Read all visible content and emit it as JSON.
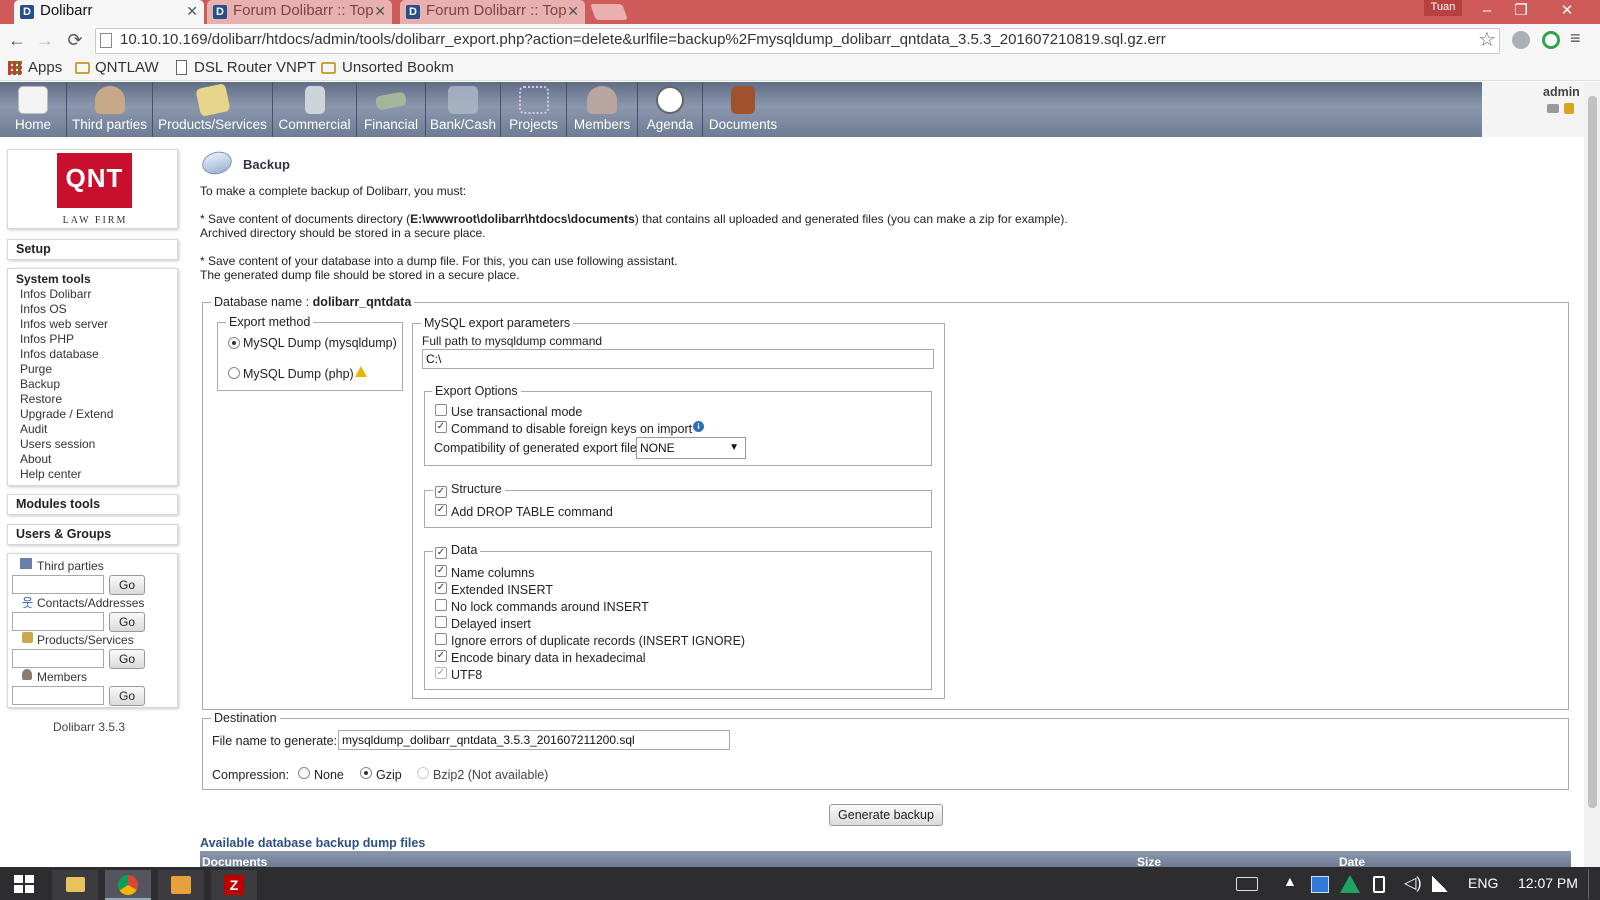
{
  "browser": {
    "tabs": [
      {
        "title": "Dolibarr",
        "favicon": "D",
        "active": true
      },
      {
        "title": "Forum Dolibarr :: Top",
        "favicon": "D",
        "active": false
      },
      {
        "title": "Forum Dolibarr :: Top",
        "favicon": "D",
        "active": false
      }
    ],
    "user_chip": "Tuan",
    "url": "10.10.10.169/dolibarr/htdocs/admin/tools/dolibarr_export.php?action=delete&urlfile=backup%2Fmysqldump_dolibarr_qntdata_3.5.3_201607210819.sql.gz.err",
    "bookmarks": [
      {
        "label": "Apps",
        "icon": "apps-grid-icon"
      },
      {
        "label": "QNTLAW",
        "icon": "folder-icon"
      },
      {
        "label": "DSL Router VNPT",
        "icon": "page-icon"
      },
      {
        "label": "Unsorted Bookm",
        "icon": "folder-icon"
      }
    ],
    "colors": {
      "tabbar": "#cf5a5a",
      "active_tab": "#f6f6f6"
    }
  },
  "app": {
    "menu": [
      {
        "label": "Home",
        "icon": "home-icon",
        "color": "#f3f3f3"
      },
      {
        "label": "Third parties",
        "icon": "third-parties-icon",
        "color": "#c7a98a"
      },
      {
        "label": "Products/Services",
        "icon": "products-icon",
        "color": "#e6d68a"
      },
      {
        "label": "Commercial",
        "icon": "commercial-icon",
        "color": "#cfd3da"
      },
      {
        "label": "Financial",
        "icon": "financial-icon",
        "color": "#a3b59a"
      },
      {
        "label": "Bank/Cash",
        "icon": "bank-icon",
        "color": "#aeb8c8"
      },
      {
        "label": "Projects",
        "icon": "projects-icon",
        "color": "#b7a6d0"
      },
      {
        "label": "Members",
        "icon": "members-icon",
        "color": "#b8a5a0"
      },
      {
        "label": "Agenda",
        "icon": "clock-icon",
        "color": "#ffffff"
      },
      {
        "label": "Documents",
        "icon": "documents-icon",
        "color": "#a0522d"
      }
    ],
    "user": "admin",
    "logo": {
      "letters": "QNT",
      "tagline": "LAW FIRM"
    },
    "sidebar": {
      "setup": "Setup",
      "system_tools": {
        "title": "System tools",
        "items": [
          "Infos Dolibarr",
          "Infos OS",
          "Infos web server",
          "Infos PHP",
          "Infos database",
          "Purge",
          "Backup",
          "Restore",
          "Upgrade / Extend",
          "Audit",
          "Users session",
          "About",
          "Help center"
        ]
      },
      "modules_tools": "Modules tools",
      "users_groups": "Users & Groups",
      "search": [
        {
          "label": "Third parties",
          "icon": "third-parties-small-icon",
          "button": "Go"
        },
        {
          "label": "Contacts/Addresses",
          "icon": "contact-small-icon",
          "button": "Go"
        },
        {
          "label": "Products/Services",
          "icon": "product-small-icon",
          "button": "Go"
        },
        {
          "label": "Members",
          "icon": "member-small-icon",
          "button": "Go"
        }
      ],
      "version": "Dolibarr 3.5.3"
    },
    "page": {
      "title": "Backup",
      "intro": "To make a complete backup of Dolibarr, you must:",
      "docs_pre": "* Save content of documents directory (",
      "docs_path": "E:\\wwwroot\\dolibarr\\htdocs\\documents",
      "docs_post": ") that contains all uploaded and generated files (you can make a zip for example).",
      "docs_line2": "Archived directory should be stored in a secure place.",
      "db_line1": "* Save content of your database into a dump file. For this, you can use following assistant.",
      "db_line2": "The generated dump file should be stored in a secure place.",
      "dbname_label": "Database name : ",
      "dbname": "dolibarr_qntdata",
      "export_method": {
        "legend": "Export method",
        "options": [
          {
            "label": "MySQL Dump (mysqldump)",
            "selected": true
          },
          {
            "label": "MySQL Dump (php)",
            "selected": false,
            "warning": true
          }
        ]
      },
      "params": {
        "legend": "MySQL export parameters",
        "path_label": "Full path to mysqldump command",
        "path_value": "C:\\",
        "export_options": {
          "legend": "Export Options",
          "checks": [
            {
              "label": "Use transactional mode",
              "checked": false
            },
            {
              "label": "Command to disable foreign keys on import",
              "checked": true,
              "info": true
            }
          ],
          "compat_label": "Compatibility of generated export file",
          "compat_value": "NONE"
        },
        "structure": {
          "legend": "Structure",
          "checked": true,
          "checks": [
            {
              "label": "Add DROP TABLE command",
              "checked": true
            }
          ]
        },
        "data": {
          "legend": "Data",
          "checked": true,
          "checks": [
            {
              "label": "Name columns",
              "checked": true
            },
            {
              "label": "Extended INSERT",
              "checked": true
            },
            {
              "label": "No lock commands around INSERT",
              "checked": false
            },
            {
              "label": "Delayed insert",
              "checked": false
            },
            {
              "label": "Ignore errors of duplicate records (INSERT IGNORE)",
              "checked": false
            },
            {
              "label": "Encode binary data in hexadecimal",
              "checked": true
            },
            {
              "label": "UTF8",
              "checked": true,
              "disabled": true
            }
          ]
        }
      },
      "destination": {
        "legend": "Destination",
        "file_label": "File name to generate:",
        "file_value": "mysqldump_dolibarr_qntdata_3.5.3_201607211200.sql",
        "compression_label": "Compression:",
        "compression": [
          {
            "label": "None",
            "selected": false,
            "disabled": false
          },
          {
            "label": "Gzip",
            "selected": true,
            "disabled": false
          },
          {
            "label": "Bzip2 (Not available)",
            "selected": false,
            "disabled": true
          }
        ]
      },
      "generate_button": "Generate backup",
      "files_title": "Available database backup dump files",
      "files_columns": [
        "Documents",
        "Size",
        "Date"
      ]
    }
  },
  "taskbar": {
    "language": "ENG",
    "time": "12:07 PM",
    "apps": [
      "windows-start-icon",
      "file-explorer-icon",
      "chrome-icon",
      "outlook-icon",
      "filezilla-icon"
    ]
  }
}
